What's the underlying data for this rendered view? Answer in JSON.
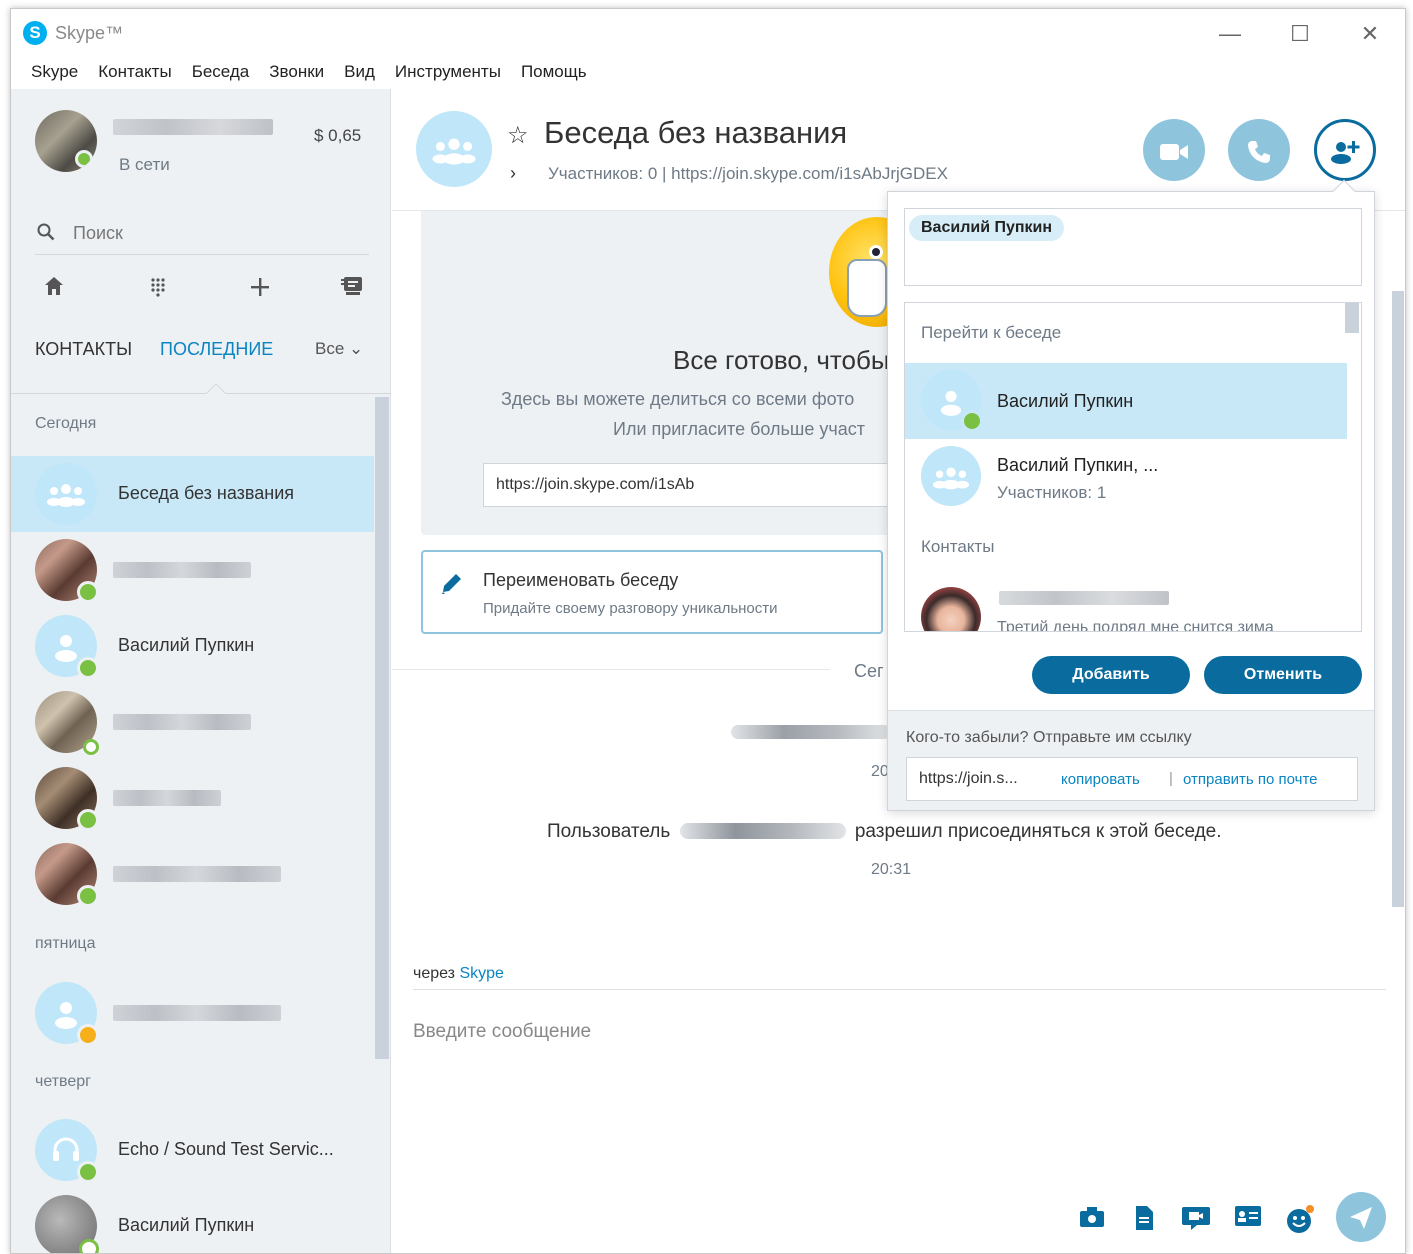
{
  "window": {
    "app_title": "Skype™",
    "controls": {
      "minimize": "—",
      "maximize": "☐",
      "close": "✕"
    }
  },
  "menu": [
    "Skype",
    "Контакты",
    "Беседа",
    "Звонки",
    "Вид",
    "Инструменты",
    "Помощь"
  ],
  "profile": {
    "status": "В сети",
    "credit": "$ 0,65"
  },
  "search": {
    "placeholder": "Поиск"
  },
  "tabs": {
    "contacts": "КОНТАКТЫ",
    "recent": "ПОСЛЕДНИЕ",
    "filter": "Все ⌄"
  },
  "recent": {
    "sections": {
      "today": "Сегодня",
      "friday": "пятница",
      "thursday": "четверг"
    },
    "items": [
      {
        "name": "Беседа без названия",
        "selected": true
      },
      {
        "name": "Василий Пупкин"
      },
      {
        "name": "Echo / Sound Test Servic..."
      },
      {
        "name": "Василий Пупкин"
      }
    ]
  },
  "chat": {
    "title": "Беседа без названия",
    "meta": "Участников: 0  |  https://join.skype.com/i1sAbJrjGDEX",
    "welcome_title": "Все готово, чтобы",
    "welcome_sub1": "Здесь вы можете делиться со всеми фото",
    "welcome_sub2": "Или пригласите больше участ",
    "welcome_link": "https://join.skype.com/i1sAb",
    "rename_title": "Переименовать беседу",
    "rename_sub": "Придайте своему разговору уникальности",
    "day_label": "Сег",
    "time1": "20",
    "msg_prefix": "Пользователь",
    "msg_suffix": "разрешил присоединяться к этой беседе.",
    "time2": "20:31",
    "via_prefix": "через",
    "via_link": "Skype",
    "compose_placeholder": "Введите сообщение"
  },
  "popup": {
    "token": "Василий Пупкин",
    "section_goto": "Перейти к беседе",
    "item1_name": "Василий Пупкин",
    "item2_name": "Василий Пупкин, ...",
    "item2_sub": "Участников: 1",
    "section_contacts": "Контакты",
    "cut_text": "Третий день подряд мне снится зима",
    "add_button": "Добавить",
    "cancel_button": "Отменить",
    "forgot": "Кого-то забыли? Отправьте им ссылку",
    "share_url": "https://join.s...",
    "copy": "копировать",
    "separator": "|",
    "email": "отправить по почте"
  },
  "colors": {
    "accent": "#0a6c9e",
    "selection": "#c9e8f7",
    "online": "#7ac143",
    "away": "#f8b01a"
  }
}
